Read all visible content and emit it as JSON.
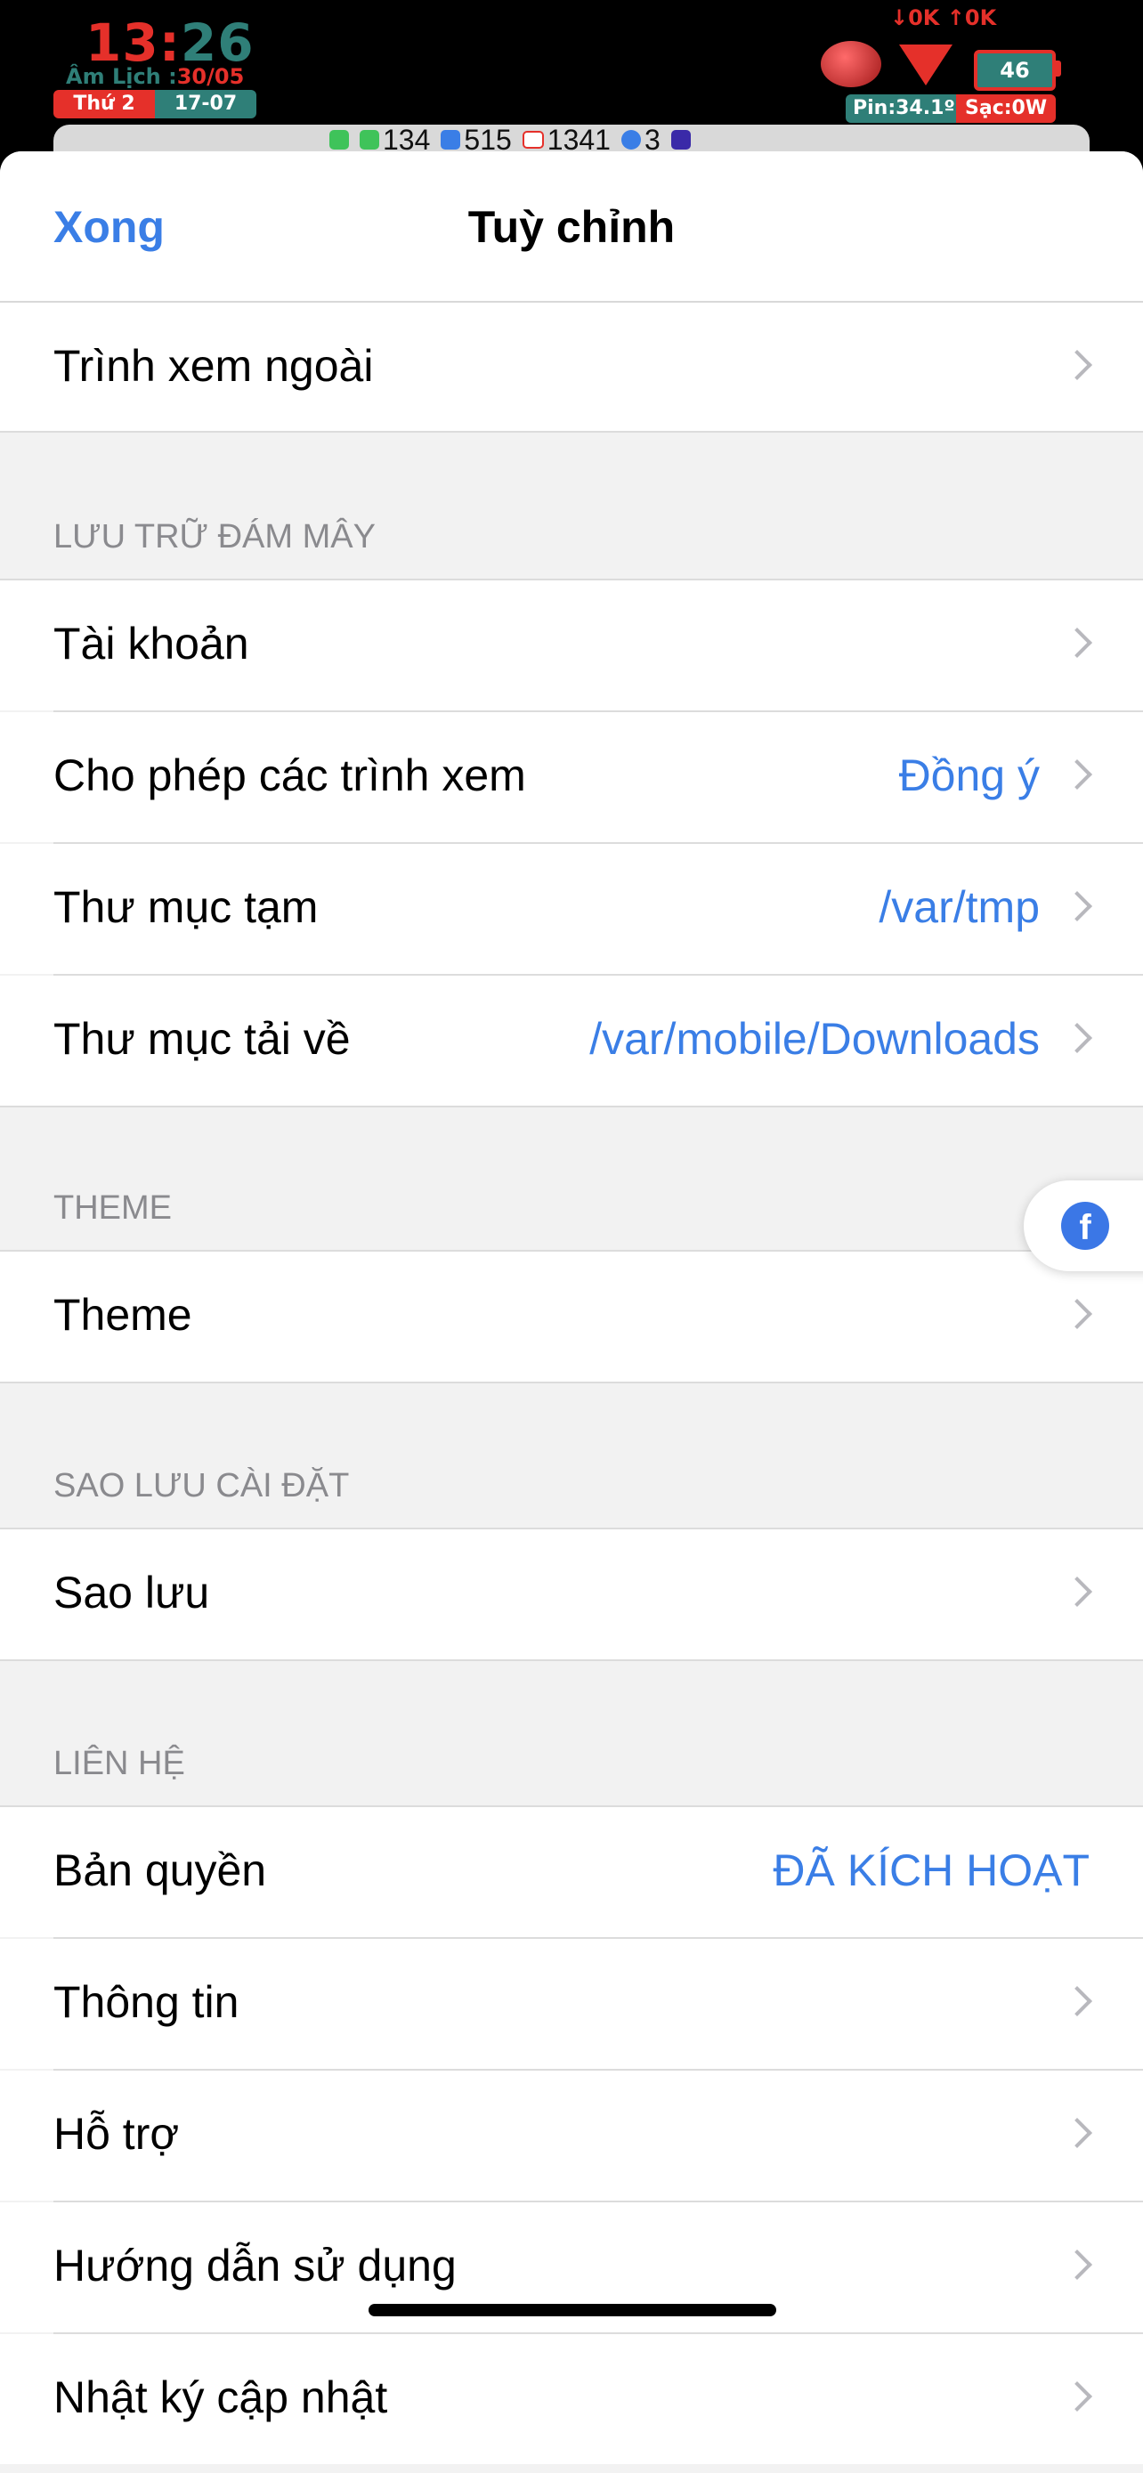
{
  "status_bar": {
    "time_hour": "13:",
    "time_min": "26",
    "lunar_label": "Âm Lịch :",
    "lunar_date": "30/05",
    "weekday": "Thứ 2",
    "date": "17-07",
    "network": "↓0K ↑0K",
    "battery": "46",
    "temp": "Pin:34.1º",
    "charge": "Sạc:0W",
    "notifications": [
      {
        "icon": "phone-icon",
        "count": ""
      },
      {
        "icon": "message-icon",
        "count": "134"
      },
      {
        "icon": "app-icon",
        "count": "515"
      },
      {
        "icon": "mail-icon",
        "count": "1341"
      },
      {
        "icon": "messenger-icon",
        "count": "3"
      },
      {
        "icon": "star-app-icon",
        "count": ""
      }
    ]
  },
  "nav": {
    "done": "Xong",
    "title": "Tuỳ chỉnh"
  },
  "rows": {
    "external_viewer": "Trình xem ngoài"
  },
  "sections": {
    "cloud": "LƯU TRỮ ĐÁM MÂY",
    "theme": "THEME",
    "backup": "SAO LƯU CÀI ĐẶT",
    "contact": "LIÊN HỆ"
  },
  "cloud_rows": [
    {
      "label": "Tài khoản",
      "value": ""
    },
    {
      "label": "Cho phép các trình xem",
      "value": "Đồng ý"
    },
    {
      "label": "Thư mục tạm",
      "value": "/var/tmp"
    },
    {
      "label": "Thư mục tải về",
      "value": "/var/mobile/Downloads"
    }
  ],
  "theme_rows": [
    {
      "label": "Theme"
    }
  ],
  "backup_rows": [
    {
      "label": "Sao lưu"
    }
  ],
  "contact_rows": [
    {
      "label": "Bản quyền",
      "value": "ĐÃ KÍCH HOẠT"
    },
    {
      "label": "Thông tin"
    },
    {
      "label": "Hỗ trợ"
    },
    {
      "label": "Hướng dẫn sử dụng"
    },
    {
      "label": "Nhật ký cập nhật"
    }
  ],
  "floating": {
    "icon": "facebook-icon",
    "glyph": "f"
  },
  "colors": {
    "accent": "#3a7ee6",
    "status_red": "#e5302a",
    "status_teal": "#2f7f78"
  }
}
